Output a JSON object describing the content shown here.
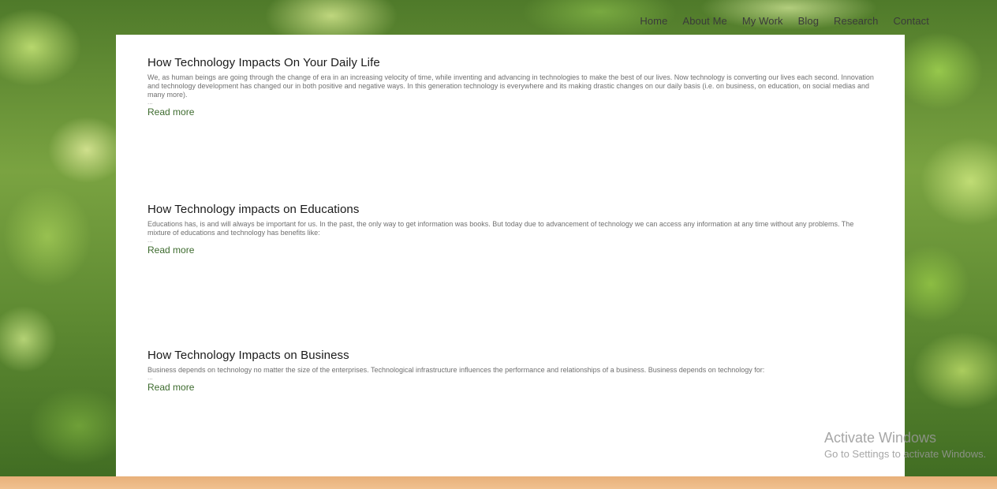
{
  "nav": {
    "items": [
      "Home",
      "About Me",
      "My Work",
      "Blog",
      "Research",
      "Contact"
    ]
  },
  "posts": [
    {
      "title": "How Technology Impacts On Your Daily Life",
      "excerpt": "We, as human beings are going through the change of era in an increasing velocity of time, while inventing and advancing in technologies to make the best of our lives. Now technology is converting our lives each second. Innovation and technology development has changed our in both positive and negative ways. In this generation technology is everywhere and its making drastic changes on our daily basis (i.e. on business, on education, on social medias and many more).",
      "ellipsis": "...",
      "read_more": "Read more"
    },
    {
      "title": "How Technology impacts on Educations",
      "excerpt": "Educations has, is and will always be important for us. In the past, the only way to get information was books. But today due to advancement of technology we can access any information at any time without any problems. The mixture of educations and technology has benefits like:",
      "ellipsis": "...",
      "read_more": "Read more"
    },
    {
      "title": "How Technology Impacts on Business",
      "excerpt": "Business depends on technology no matter the size of the enterprises. Technological infrastructure influences the performance and relationships of a business. Business depends on technology for:",
      "ellipsis": "...",
      "read_more": "Read more"
    }
  ],
  "watermark": {
    "line1": "Activate Windows",
    "line2": "Go to Settings to activate Windows."
  }
}
